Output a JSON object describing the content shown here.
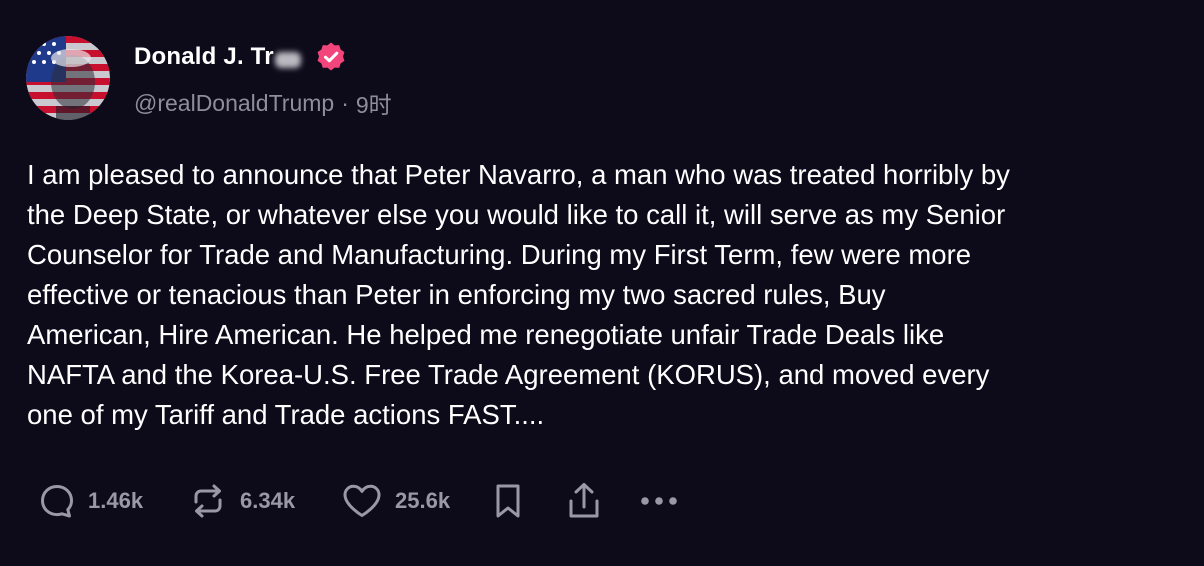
{
  "post": {
    "author": {
      "display_name": "Donald J. Tr",
      "handle": "@realDonaldTrump",
      "separator": "·",
      "time": "9时",
      "avatar_icon": "flag-portrait-avatar",
      "verified_icon": "verified-badge-icon",
      "verified_color": "#f2457c"
    },
    "text_lines": [
      "I am pleased to announce that Peter Navarro, a man who was treated horribly by",
      "the Deep State, or whatever else you would like to call it, will serve as my Senior",
      "Counselor for Trade and Manufacturing. During my First Term, few were more",
      "effective or tenacious than Peter in enforcing my two sacred rules, Buy",
      "American, Hire American. He helped me renegotiate unfair Trade Deals like",
      "NAFTA and the Korea-U.S. Free Trade Agreement (KORUS), and moved every",
      "one of my Tariff and Trade actions FAST...."
    ],
    "actions": {
      "replies": {
        "icon": "reply-bubble-icon",
        "count": "1.46k"
      },
      "reposts": {
        "icon": "repost-icon",
        "count": "6.34k"
      },
      "likes": {
        "icon": "heart-icon",
        "count": "25.6k"
      },
      "bookmark": {
        "icon": "bookmark-icon"
      },
      "share": {
        "icon": "share-icon"
      },
      "more": {
        "icon": "more-dots-icon"
      }
    }
  },
  "colors": {
    "background": "#0d0a1a",
    "text": "#ffffff",
    "muted": "#8f8c9b"
  }
}
